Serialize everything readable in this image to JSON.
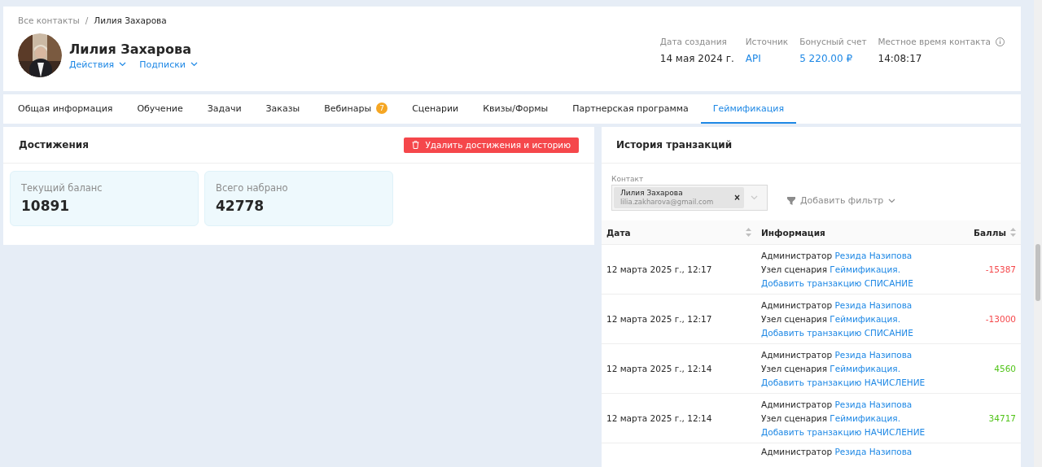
{
  "breadcrumb_separator": "/",
  "breadcrumbs": [
    {
      "label": "Все контакты",
      "current": false
    },
    {
      "label": "Лилия Захарова",
      "current": true
    }
  ],
  "contact": {
    "avatar": {
      "kind": "picture"
    },
    "name": "Лилия Захарова",
    "menus": [
      "Действия",
      "Подписки"
    ]
  },
  "stats": [
    {
      "label": "Дата создания",
      "value": "14 мая 2024 г.",
      "link": false,
      "info": false
    },
    {
      "label": "Источник",
      "value": "API",
      "link": true,
      "info": false
    },
    {
      "label": "Бонусный счет",
      "value": "5 220.00 ₽",
      "link": true,
      "info": false
    },
    {
      "label": "Местное время контакта",
      "value": "14:08:17",
      "link": false,
      "info": true
    }
  ],
  "tabs": [
    {
      "label": "Общая информация",
      "selected": false
    },
    {
      "label": "Обучение",
      "selected": false
    },
    {
      "label": "Задачи",
      "selected": false
    },
    {
      "label": "Заказы",
      "selected": false
    },
    {
      "label": "Вебинары",
      "selected": false,
      "badge": "7"
    },
    {
      "label": "Сценарии",
      "selected": false
    },
    {
      "label": "Квизы/Формы",
      "selected": false
    },
    {
      "label": "Партнерская программа",
      "selected": false
    },
    {
      "label": "Геймификация",
      "selected": true
    }
  ],
  "achievements": {
    "title": "Достижения",
    "delete_button": "Удалить достижения и историю",
    "cards": [
      {
        "label": "Текущий баланс",
        "value": "10891"
      },
      {
        "label": "Всего набрано",
        "value": "42778"
      }
    ]
  },
  "history": {
    "title": "История транзакций",
    "contact_filter": {
      "label": "Контакт",
      "name": "Лилия Захарова",
      "email": "lilia.zakharova@gmail.com",
      "clear": "×"
    },
    "add_filter": "Добавить фильтр",
    "columns": [
      {
        "label": "Дата",
        "sortable": true
      },
      {
        "label": "Информация",
        "sortable": false
      },
      {
        "label": "Баллы",
        "sortable": true
      }
    ],
    "rows": [
      {
        "date": "12 марта 2025 г., 12:17",
        "actor_label": "Администратор",
        "actor": "Резида Назипова",
        "node_label": "Узел сценария",
        "node": "Геймификация.",
        "action": "Добавить транзакцию СПИСАНИЕ",
        "points": "-15387",
        "kind": "debit"
      },
      {
        "date": "12 марта 2025 г., 12:17",
        "actor_label": "Администратор",
        "actor": "Резида Назипова",
        "node_label": "Узел сценария",
        "node": "Геймификация.",
        "action": "Добавить транзакцию СПИСАНИЕ",
        "points": "-13000",
        "kind": "debit"
      },
      {
        "date": "12 марта 2025 г., 12:14",
        "actor_label": "Администратор",
        "actor": "Резида Назипова",
        "node_label": "Узел сценария",
        "node": "Геймификация.",
        "action": "Добавить транзакцию НАЧИСЛЕНИЕ",
        "points": "4560",
        "kind": "credit"
      },
      {
        "date": "12 марта 2025 г., 12:14",
        "actor_label": "Администратор",
        "actor": "Резида Назипова",
        "node_label": "Узел сценария",
        "node": "Геймификация.",
        "action": "Добавить транзакцию НАЧИСЛЕНИЕ",
        "points": "34717",
        "kind": "credit"
      },
      {
        "actor_label": "Администратор",
        "actor": "Резида Назипова"
      }
    ]
  }
}
